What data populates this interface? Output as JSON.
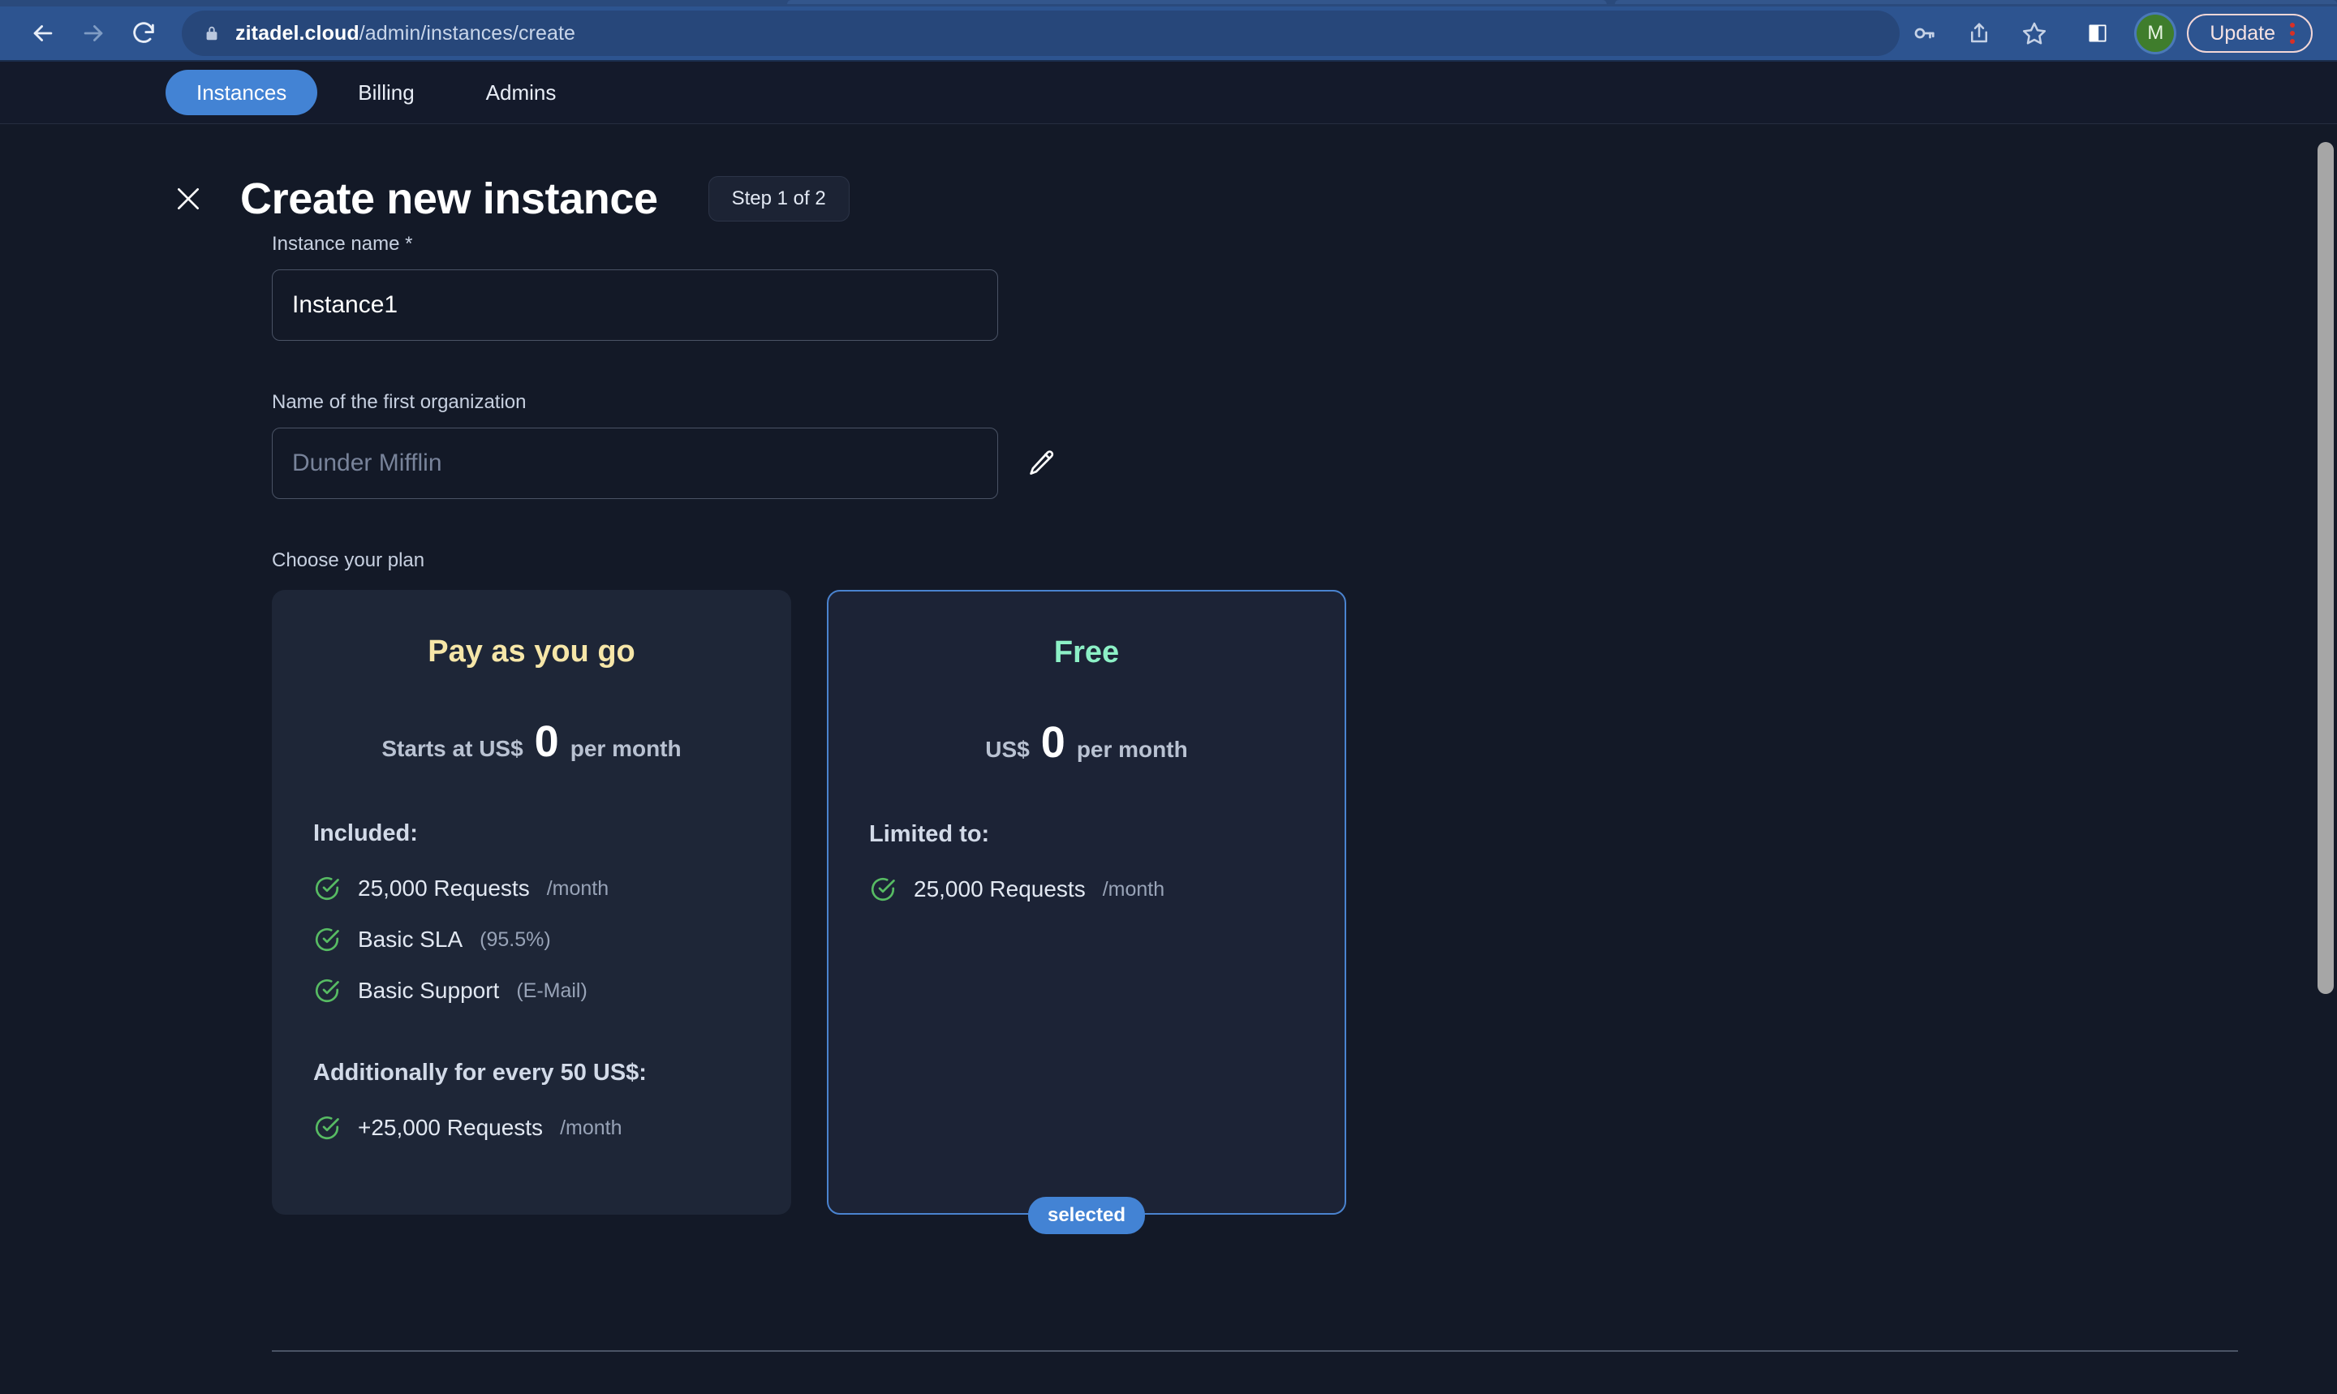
{
  "browser": {
    "url_host": "zitadel.cloud",
    "url_path": "/admin/instances/create",
    "back_icon": "back-arrow-icon",
    "forward_icon": "forward-arrow-icon",
    "reload_icon": "reload-icon",
    "lock_icon": "lock-icon",
    "password_icon": "key-icon",
    "share_icon": "share-icon",
    "bookmark_icon": "star-icon",
    "sidepanel_icon": "side-panel-icon",
    "profile_initial": "M",
    "update_label": "Update",
    "menu_icon": "kebab-menu-icon"
  },
  "app_nav": {
    "tabs": [
      {
        "label": "Instances",
        "active": true
      },
      {
        "label": "Billing",
        "active": false
      },
      {
        "label": "Admins",
        "active": false
      }
    ]
  },
  "header": {
    "close_icon": "close-icon",
    "title": "Create new instance",
    "step_label": "Step 1 of 2"
  },
  "form": {
    "instance_name": {
      "label": "Instance name *",
      "value": "Instance1",
      "placeholder": ""
    },
    "organization": {
      "label": "Name of the first organization",
      "value": "",
      "placeholder": "Dunder Mifflin",
      "edit_icon": "pencil-edit-icon"
    }
  },
  "plans": {
    "section_label": "Choose your plan",
    "items": [
      {
        "name": "Pay as you go",
        "name_color": "#f6e6a8",
        "selected": false,
        "price_pre": "Starts at US$",
        "price_amount": "0",
        "price_post": "per month",
        "groups": [
          {
            "title": "Included:",
            "features": [
              {
                "main": "25,000 Requests",
                "sub": "/month"
              },
              {
                "main": "Basic SLA",
                "sub": "(95.5%)"
              },
              {
                "main": "Basic Support",
                "sub": "(E-Mail)"
              }
            ]
          },
          {
            "title": "Additionally for every 50 US$:",
            "features": [
              {
                "main": "+25,000 Requests",
                "sub": "/month"
              }
            ]
          }
        ]
      },
      {
        "name": "Free",
        "name_color": "#8cf0c6",
        "selected": true,
        "selected_label": "selected",
        "price_pre": "US$",
        "price_amount": "0",
        "price_post": "per month",
        "groups": [
          {
            "title": "Limited to:",
            "features": [
              {
                "main": "25,000 Requests",
                "sub": "/month"
              }
            ]
          }
        ]
      }
    ]
  },
  "colors": {
    "accent_blue": "#4383d4",
    "check_green": "#57bb63",
    "page_bg": "#131927",
    "card_bg": "#1e2637"
  }
}
